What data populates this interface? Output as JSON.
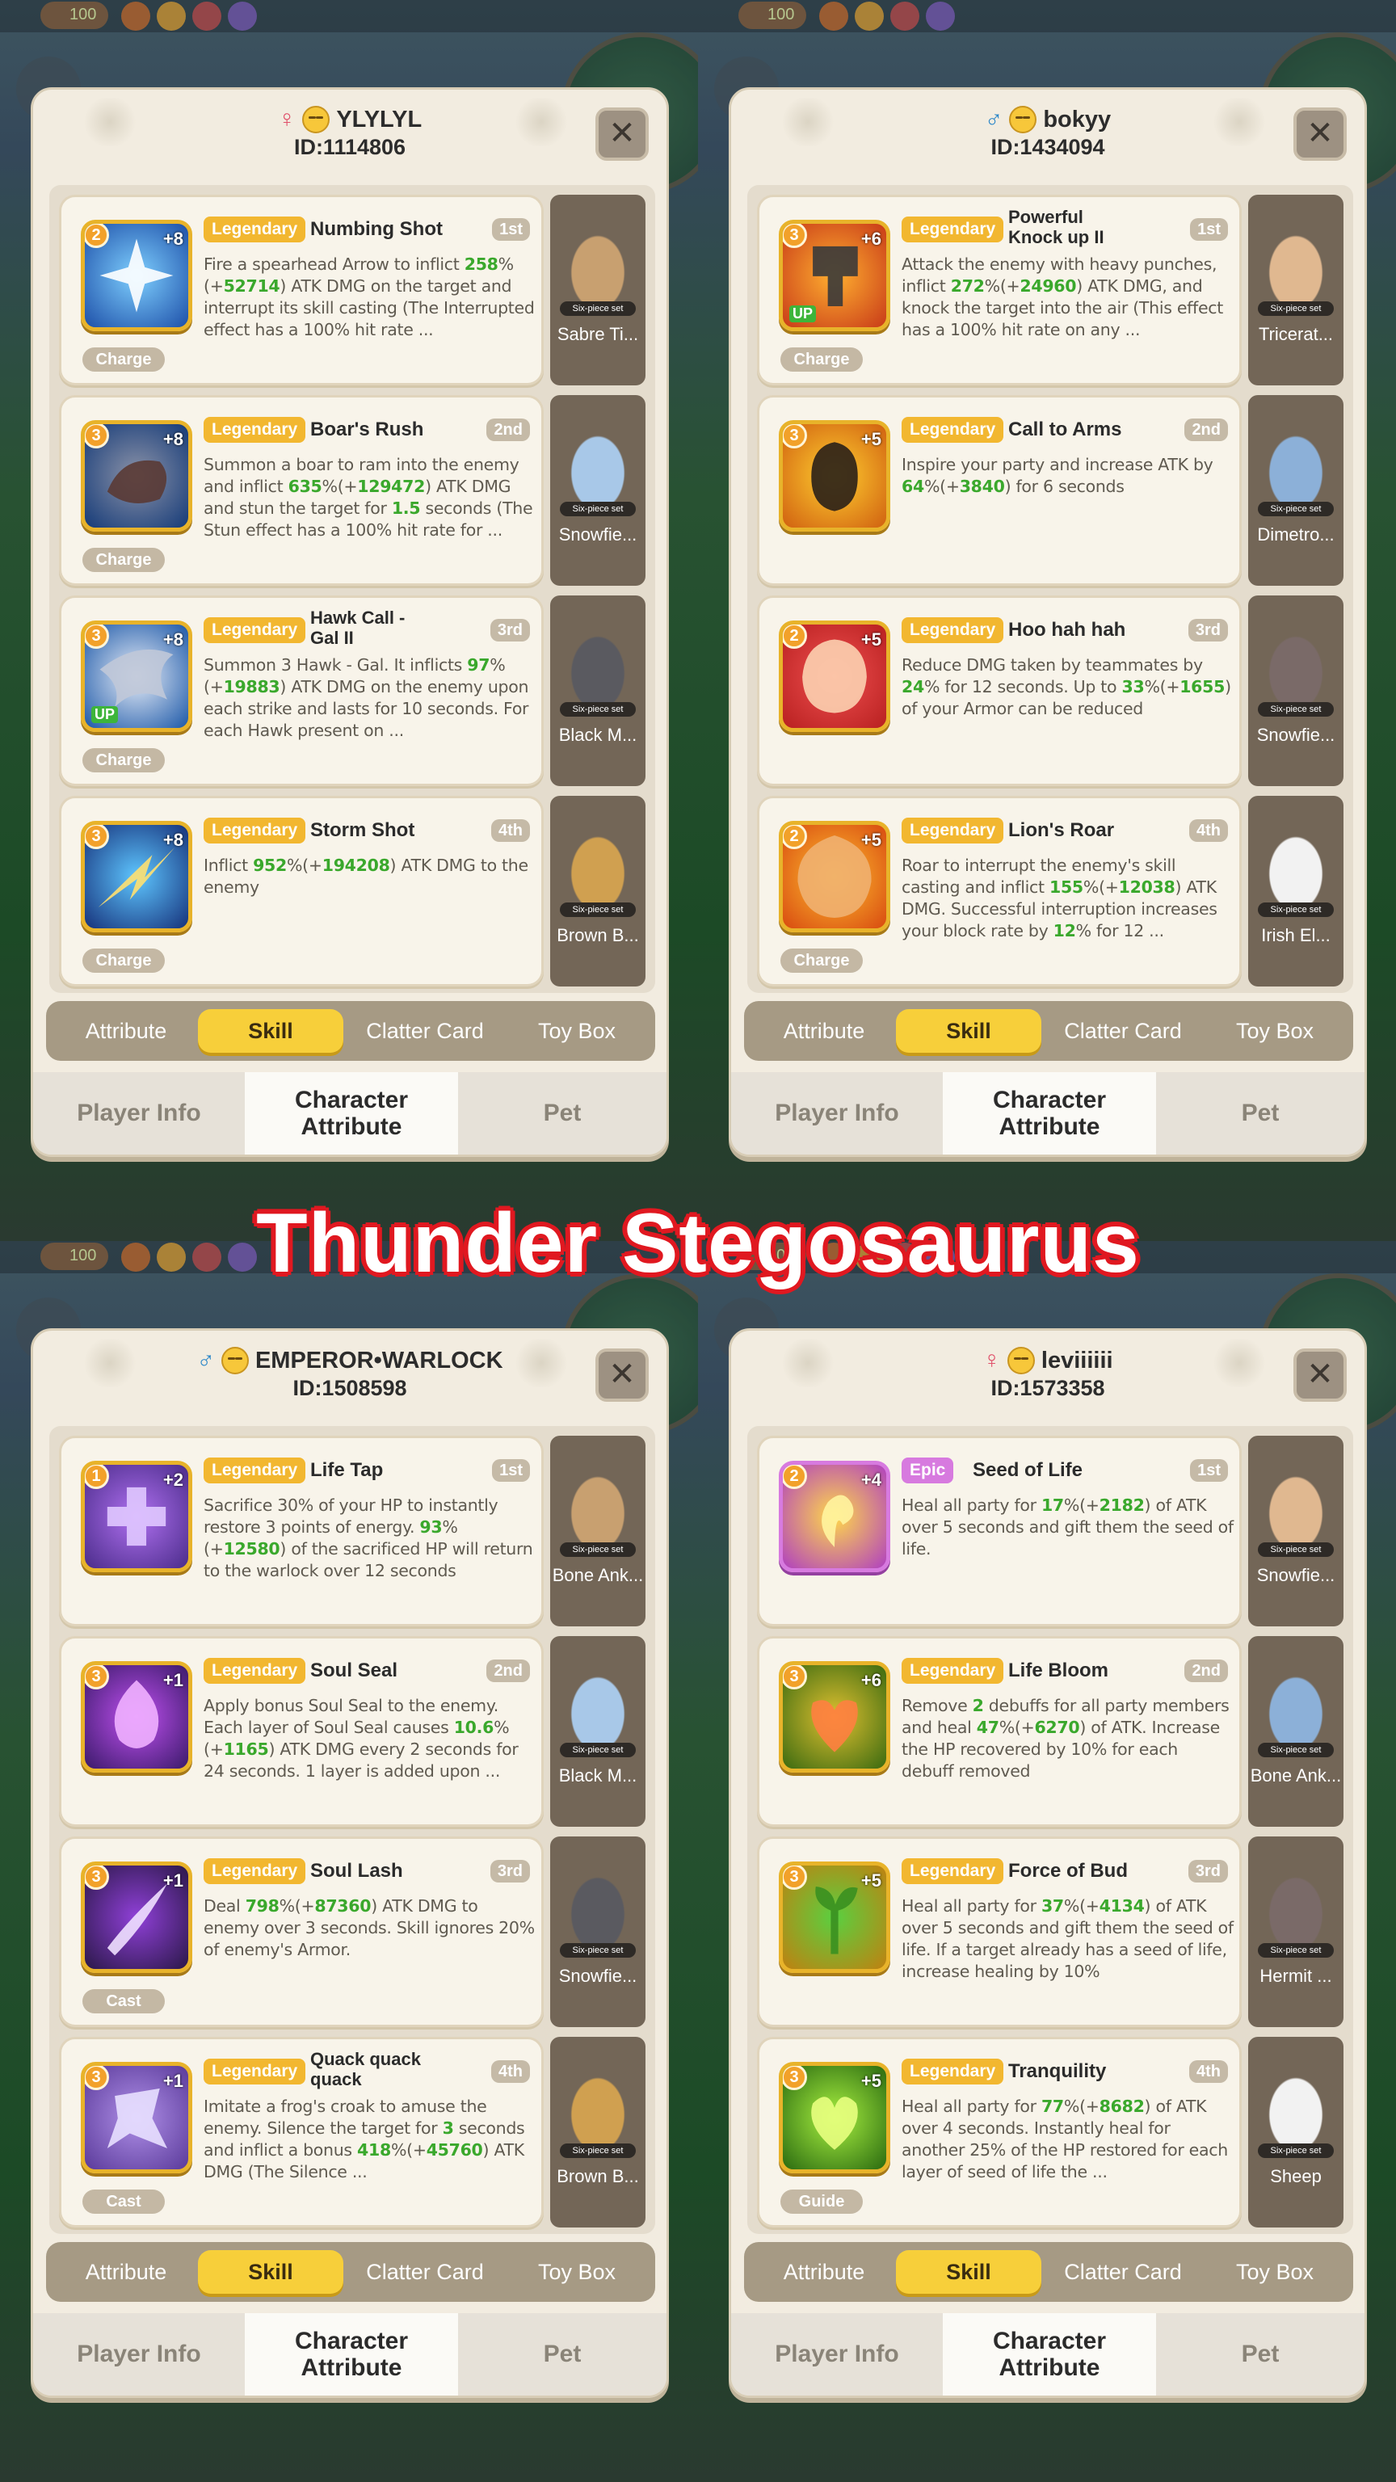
{
  "banner": "Thunder Stegosaurus",
  "top_bar": {
    "level": "100"
  },
  "common": {
    "close_symbol": "✕",
    "sub_tabs": [
      "Attribute",
      "Skill",
      "Clatter Card",
      "Toy Box"
    ],
    "active_sub_tab": "Skill",
    "main_tabs": [
      "Player Info",
      "Character Attribute",
      "Pet"
    ],
    "active_main_tab": "Character Attribute",
    "pet_set_label": "Six-piece set"
  },
  "colors": {
    "legendary": "#f2b730",
    "epic": "#d77adf",
    "highlight": "#3aa82c",
    "active_tab": "#f7cf3a"
  },
  "panels": [
    {
      "gender_icon": "female-icon",
      "name": "YLYLYL",
      "id": "ID:1114806",
      "skills": [
        {
          "level": "2",
          "plus": "+8",
          "up": "",
          "rarity": "Legendary",
          "name": "Numbing Shot",
          "order": "1st",
          "tag": "Charge",
          "desc": [
            "Fire a spearhead Arrow to inflict ",
            {
              "h": "258"
            },
            "%(+",
            {
              "h": "52714"
            },
            ") ATK DMG on the target and interrupt its skill casting (The Interrupted effect has a 100% hit rate ..."
          ],
          "pet": "Sabre Ti...",
          "icon": "numbing-shot-icon"
        },
        {
          "level": "3",
          "plus": "+8",
          "up": "",
          "rarity": "Legendary",
          "name": "Boar's Rush",
          "order": "2nd",
          "tag": "Charge",
          "desc": [
            "Summon a boar to ram into the enemy and inflict ",
            {
              "h": "635"
            },
            "%(+",
            {
              "h": "129472"
            },
            ") ATK DMG and stun the target for ",
            {
              "h": "1.5"
            },
            " seconds (The Stun effect has a 100% hit rate for ..."
          ],
          "pet": "Snowfie...",
          "icon": "boar-rush-icon"
        },
        {
          "level": "3",
          "plus": "+8",
          "up": "UP",
          "rarity": "Legendary",
          "name": "Hawk Call - Gal II",
          "order": "3rd",
          "tag": "Charge",
          "desc": [
            "Summon 3 Hawk - Gal. It inflicts ",
            {
              "h": "97"
            },
            "%(+",
            {
              "h": "19883"
            },
            ") ATK DMG on the enemy upon each strike and lasts for 10 seconds. For each Hawk present on ..."
          ],
          "pet": "Black M...",
          "icon": "hawk-call-icon"
        },
        {
          "level": "3",
          "plus": "+8",
          "up": "",
          "rarity": "Legendary",
          "name": "Storm Shot",
          "order": "4th",
          "tag": "Charge",
          "desc": [
            "Inflict ",
            {
              "h": "952"
            },
            "%(+",
            {
              "h": "194208"
            },
            ") ATK DMG to the enemy"
          ],
          "pet": "Brown B...",
          "icon": "storm-shot-icon"
        }
      ]
    },
    {
      "gender_icon": "male-icon",
      "name": "bokyy",
      "id": "ID:1434094",
      "skills": [
        {
          "level": "3",
          "plus": "+6",
          "up": "UP",
          "rarity": "Legendary",
          "name": "Powerful Knock up II",
          "order": "1st",
          "tag": "Charge",
          "desc": [
            "Attack the enemy with heavy punches, inflict ",
            {
              "h": "272"
            },
            "%(+",
            {
              "h": "24960"
            },
            ") ATK DMG, and knock the target into the air (This effect has a 100% hit rate on any ..."
          ],
          "pet": "Tricerat...",
          "icon": "knock-up-icon"
        },
        {
          "level": "3",
          "plus": "+5",
          "up": "",
          "rarity": "Legendary",
          "name": "Call to Arms",
          "order": "2nd",
          "tag": "",
          "desc": [
            "Inspire your party and increase ATK by ",
            {
              "h": "64"
            },
            "%(+",
            {
              "h": "3840"
            },
            ") for 6 seconds"
          ],
          "pet": "Dimetro...",
          "icon": "call-to-arms-icon"
        },
        {
          "level": "2",
          "plus": "+5",
          "up": "",
          "rarity": "Legendary",
          "name": "Hoo hah hah",
          "order": "3rd",
          "tag": "",
          "desc": [
            "Reduce DMG taken by teammates by ",
            {
              "h": "24"
            },
            "% for 12 seconds. Up to ",
            {
              "h": "33"
            },
            "%(+",
            {
              "h": "1655"
            },
            ") of your Armor can be reduced"
          ],
          "pet": "Snowfie...",
          "icon": "hoo-hah-icon"
        },
        {
          "level": "2",
          "plus": "+5",
          "up": "",
          "rarity": "Legendary",
          "name": "Lion's Roar",
          "order": "4th",
          "tag": "Charge",
          "desc": [
            "Roar to interrupt the enemy's skill casting and inflict ",
            {
              "h": "155"
            },
            "%(+",
            {
              "h": "12038"
            },
            ") ATK DMG. Successful interruption increases your block rate by ",
            {
              "h": "12"
            },
            "% for 12 ..."
          ],
          "pet": "Irish El...",
          "icon": "lion-roar-icon"
        }
      ]
    },
    {
      "gender_icon": "male-icon",
      "name": "EMPEROR•WARLOCK",
      "id": "ID:1508598",
      "skills": [
        {
          "level": "1",
          "plus": "+2",
          "up": "",
          "rarity": "Legendary",
          "name": "Life Tap",
          "order": "1st",
          "tag": "",
          "desc": [
            "Sacrifice 30% of your HP to instantly restore 3 points of energy. ",
            {
              "h": "93"
            },
            "%(+",
            {
              "h": "12580"
            },
            ") of the sacrificed HP will return to the warlock over 12 seconds"
          ],
          "pet": "Bone Ank...",
          "icon": "life-tap-icon"
        },
        {
          "level": "3",
          "plus": "+1",
          "up": "",
          "rarity": "Legendary",
          "name": "Soul Seal",
          "order": "2nd",
          "tag": "",
          "desc": [
            "Apply bonus Soul Seal to the enemy. Each layer of Soul Seal causes ",
            {
              "h": "10.6"
            },
            "%(+",
            {
              "h": "1165"
            },
            ") ATK DMG every 2 seconds for 24 seconds. 1 layer is added upon ..."
          ],
          "pet": "Black M...",
          "icon": "soul-seal-icon"
        },
        {
          "level": "3",
          "plus": "+1",
          "up": "",
          "rarity": "Legendary",
          "name": "Soul Lash",
          "order": "3rd",
          "tag": "Cast",
          "desc": [
            "Deal ",
            {
              "h": "798"
            },
            "%(+",
            {
              "h": "87360"
            },
            ") ATK DMG to enemy over 3 seconds. Skill ignores 20% of enemy's Armor."
          ],
          "pet": "Snowfie...",
          "icon": "soul-lash-icon"
        },
        {
          "level": "3",
          "plus": "+1",
          "up": "",
          "rarity": "Legendary",
          "name": "Quack quack quack",
          "order": "4th",
          "tag": "Cast",
          "desc": [
            "Imitate a frog's croak to amuse the enemy. Silence the target for ",
            {
              "h": "3"
            },
            " seconds and inflict a bonus ",
            {
              "h": "418"
            },
            "%(+",
            {
              "h": "45760"
            },
            ") ATK DMG (The Silence ..."
          ],
          "pet": "Brown B...",
          "icon": "quack-icon"
        }
      ]
    },
    {
      "gender_icon": "female-icon",
      "name": "leviiiiii",
      "id": "ID:1573358",
      "skills": [
        {
          "level": "2",
          "plus": "+4",
          "up": "",
          "rarity": "Epic",
          "name": "Seed of Life",
          "order": "1st",
          "tag": "",
          "desc": [
            "Heal all party for ",
            {
              "h": "17"
            },
            "%(+",
            {
              "h": "2182"
            },
            ") of ATK over 5 seconds and gift them the seed of life."
          ],
          "pet": "Snowfie...",
          "icon": "seed-of-life-icon"
        },
        {
          "level": "3",
          "plus": "+6",
          "up": "",
          "rarity": "Legendary",
          "name": "Life Bloom",
          "order": "2nd",
          "tag": "",
          "desc": [
            "Remove ",
            {
              "h": "2"
            },
            " debuffs for all party members and heal ",
            {
              "h": "47"
            },
            "%(+",
            {
              "h": "6270"
            },
            ") of ATK. Increase the HP recovered by 10% for each debuff removed"
          ],
          "pet": "Bone Ank...",
          "icon": "life-bloom-icon"
        },
        {
          "level": "3",
          "plus": "+5",
          "up": "",
          "rarity": "Legendary",
          "name": "Force of Bud",
          "order": "3rd",
          "tag": "",
          "desc": [
            "Heal all party for ",
            {
              "h": "37"
            },
            "%(+",
            {
              "h": "4134"
            },
            ") of ATK over 5 seconds and gift them the seed of life. If a target already has a seed of life, increase healing by 10%"
          ],
          "pet": "Hermit ...",
          "icon": "force-of-bud-icon"
        },
        {
          "level": "3",
          "plus": "+5",
          "up": "",
          "rarity": "Legendary",
          "name": "Tranquility",
          "order": "4th",
          "tag": "Guide",
          "desc": [
            "Heal all party for ",
            {
              "h": "77"
            },
            "%(+",
            {
              "h": "8682"
            },
            ") of ATK over 4 seconds. Instantly heal for another 25% of the HP restored for each layer of seed of life the ..."
          ],
          "pet": "Sheep",
          "icon": "tranquility-icon"
        }
      ]
    }
  ]
}
